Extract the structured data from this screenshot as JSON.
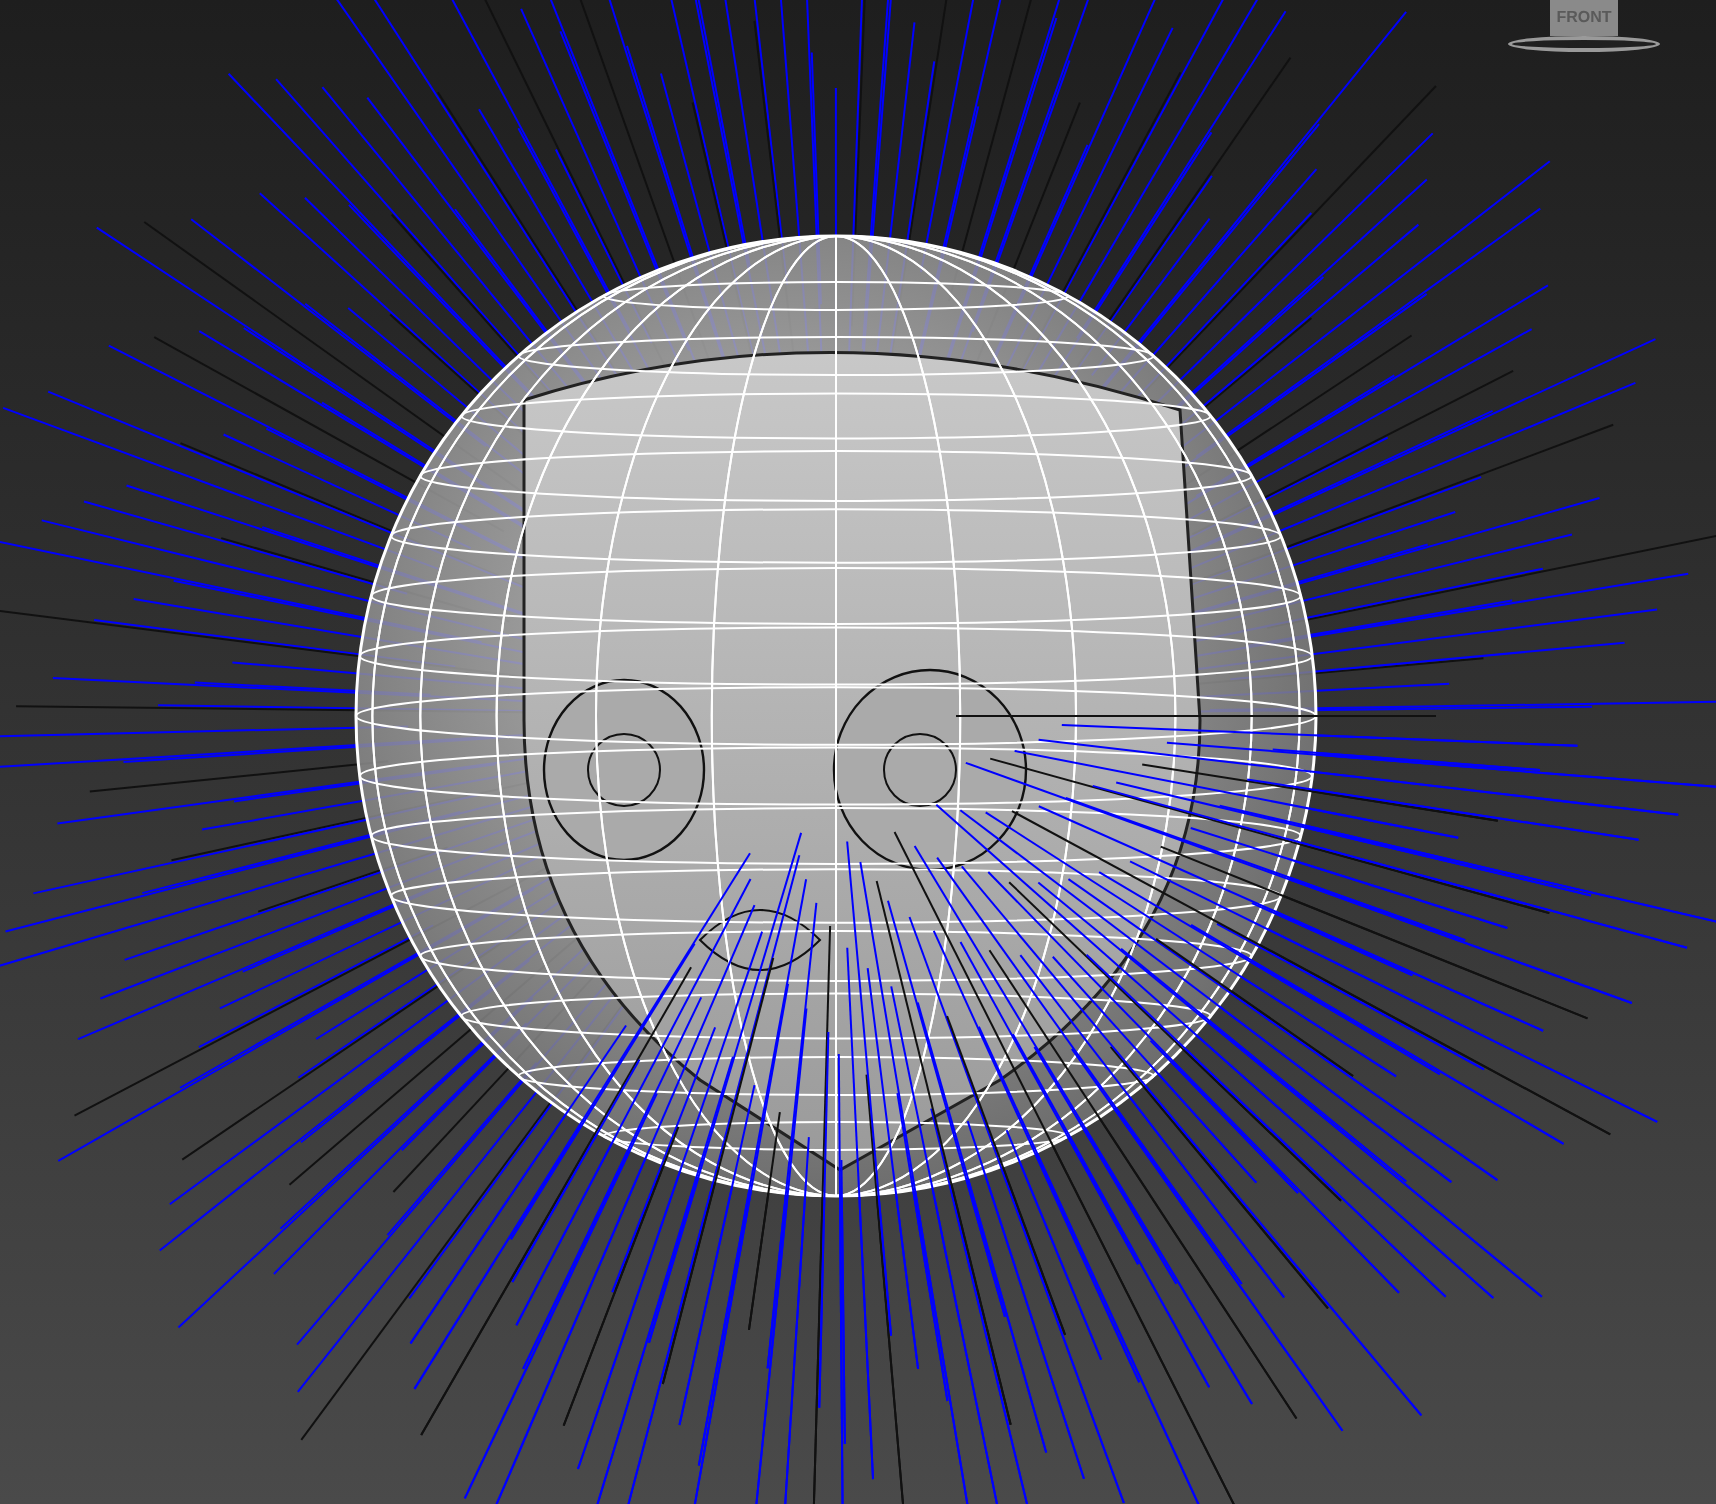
{
  "viewport": {
    "view_cube": {
      "label": "FRONT"
    }
  }
}
